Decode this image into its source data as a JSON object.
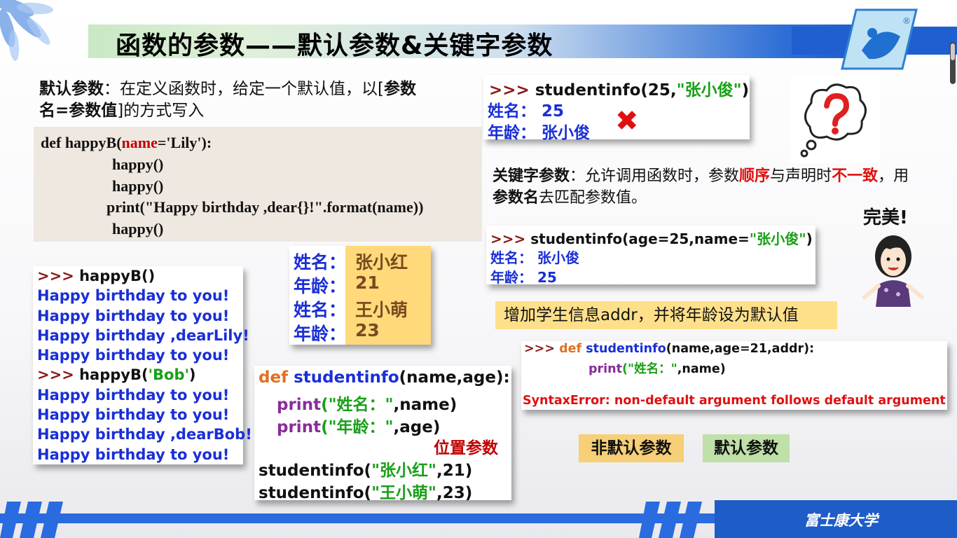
{
  "header": {
    "title": "函数的参数——默认参数&关键字参数"
  },
  "default_param": {
    "label": "默认参数",
    "text1": "：在定义函数时，给定一个默认值，以[",
    "bold1": "参数",
    "bold2": "名=参数值",
    "text2": "]的方式写入"
  },
  "code_def": {
    "line1_a": "def happyB(",
    "line1_name": "name",
    "line1_b": "='Lily'):",
    "line2": "happy()",
    "line3": "happy()",
    "line4": "print(\"Happy birthday ,dear{}!\".format(name))",
    "line5": "happy()"
  },
  "output_box": {
    "lines": [
      {
        "prompt": ">>> ",
        "text": "happyB()"
      },
      {
        "text": "Happy birthday to you!"
      },
      {
        "text": "Happy birthday to you!"
      },
      {
        "text": "Happy birthday ,dearLily!"
      },
      {
        "text": "Happy birthday to you!"
      },
      {
        "prompt": ">>> ",
        "text_a": "happyB(",
        "text_str": "'Bob'",
        "text_b": ")"
      },
      {
        "text": "Happy birthday to you!"
      },
      {
        "text": "Happy birthday to you!"
      },
      {
        "text": "Happy birthday ,dearBob!"
      },
      {
        "text": "Happy birthday to you!"
      }
    ]
  },
  "values_box": {
    "rows": [
      {
        "label": "姓名：",
        "value": "张小红"
      },
      {
        "label": "年龄：",
        "value": "21"
      },
      {
        "label": "姓名：",
        "value": "王小萌"
      },
      {
        "label": "年龄：",
        "value": "23"
      }
    ]
  },
  "code2": {
    "def_kw": "def",
    "func": " studentinfo",
    "args": "(name,age):",
    "print1_kw": "print",
    "print1_str": "(\"姓名：\"",
    "print1_rest": ",name)",
    "print2_kw": "print",
    "print2_str": "(\"年龄：\"",
    "print2_rest": ",age)",
    "positional_label": "位置参数",
    "call1_a": "studentinfo(",
    "call1_str": "\"张小红\"",
    "call1_b": ",21)",
    "call2_a": "studentinfo(",
    "call2_str": "\"王小萌\"",
    "call2_b": ",23)"
  },
  "kw_example1": {
    "prompt": ">>> ",
    "call_a": "studentinfo(25,",
    "call_str": "\"张小俊\"",
    "call_b": ")",
    "out1": "姓名： 25",
    "out2": "年龄： 张小俊"
  },
  "keyword_param": {
    "label": "关键字参数",
    "text1": "：允许调用函数时，参数",
    "red1": "顺序",
    "text2": "与声明时",
    "red2": "不一致",
    "text3": "，用",
    "bold": "参数名",
    "text4": "去匹配参数值。"
  },
  "kw_example2": {
    "prompt": ">>> ",
    "call_a": "studentinfo(age=25,name=",
    "call_str": "\"张小俊\"",
    "call_b": ")",
    "out1": "姓名： 张小俊",
    "out2": "年龄： 25"
  },
  "perfect_text": "完美!",
  "note": "增加学生信息addr，并将年龄设为默认值",
  "error_box": {
    "prompt": ">>> ",
    "def_kw": "def",
    "func": " studentinfo",
    "args": "(name,age=21,addr):",
    "print_kw": "print",
    "print_str": "(\"姓名：\"",
    "print_rest": ",name)",
    "error": "SyntaxError: non-default argument follows default argument"
  },
  "tags": {
    "non_default": "非默认参数",
    "default": "默认参数"
  },
  "footer": {
    "university": "富士康大学"
  },
  "colors": {
    "accent_blue": "#1e5cc8",
    "code_blue": "#1a2fd6",
    "string_green": "#18a018",
    "keyword_red": "#c00000"
  }
}
